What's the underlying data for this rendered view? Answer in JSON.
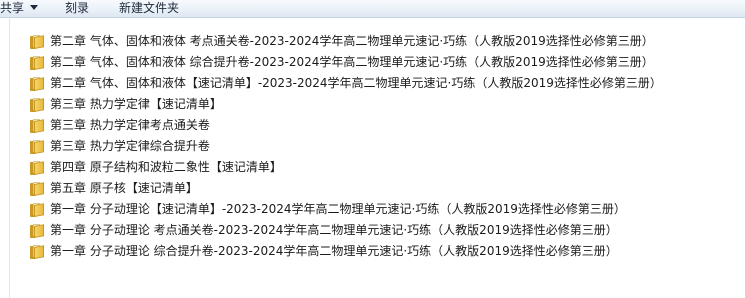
{
  "toolbar": {
    "share_label": "共享",
    "burn_label": "刻录",
    "new_folder_label": "新建文件夹"
  },
  "files": [
    {
      "name": "第二章  气体、固体和液体 考点通关卷-2023-2024学年高二物理单元速记·巧练（人教版2019选择性必修第三册）",
      "icon": "folder-icon"
    },
    {
      "name": "第二章  气体、固体和液体 综合提升卷-2023-2024学年高二物理单元速记·巧练（人教版2019选择性必修第三册）",
      "icon": "folder-icon"
    },
    {
      "name": "第二章  气体、固体和液体【速记清单】-2023-2024学年高二物理单元速记·巧练（人教版2019选择性必修第三册）",
      "icon": "folder-icon"
    },
    {
      "name": "第三章  热力学定律【速记清单】",
      "icon": "folder-icon"
    },
    {
      "name": "第三章  热力学定律考点通关卷",
      "icon": "folder-icon"
    },
    {
      "name": "第三章  热力学定律综合提升卷",
      "icon": "folder-icon"
    },
    {
      "name": "第四章  原子结构和波粒二象性【速记清单】",
      "icon": "folder-icon"
    },
    {
      "name": "第五章  原子核【速记清单】",
      "icon": "folder-icon"
    },
    {
      "name": "第一章  分子动理论【速记清单】-2023-2024学年高二物理单元速记·巧练（人教版2019选择性必修第三册）",
      "icon": "folder-icon"
    },
    {
      "name": "第一章  分子动理论 考点通关卷-2023-2024学年高二物理单元速记·巧练（人教版2019选择性必修第三册）",
      "icon": "folder-icon"
    },
    {
      "name": "第一章  分子动理论 综合提升卷-2023-2024学年高二物理单元速记·巧练（人教版2019选择性必修第三册）",
      "icon": "folder-icon"
    }
  ]
}
